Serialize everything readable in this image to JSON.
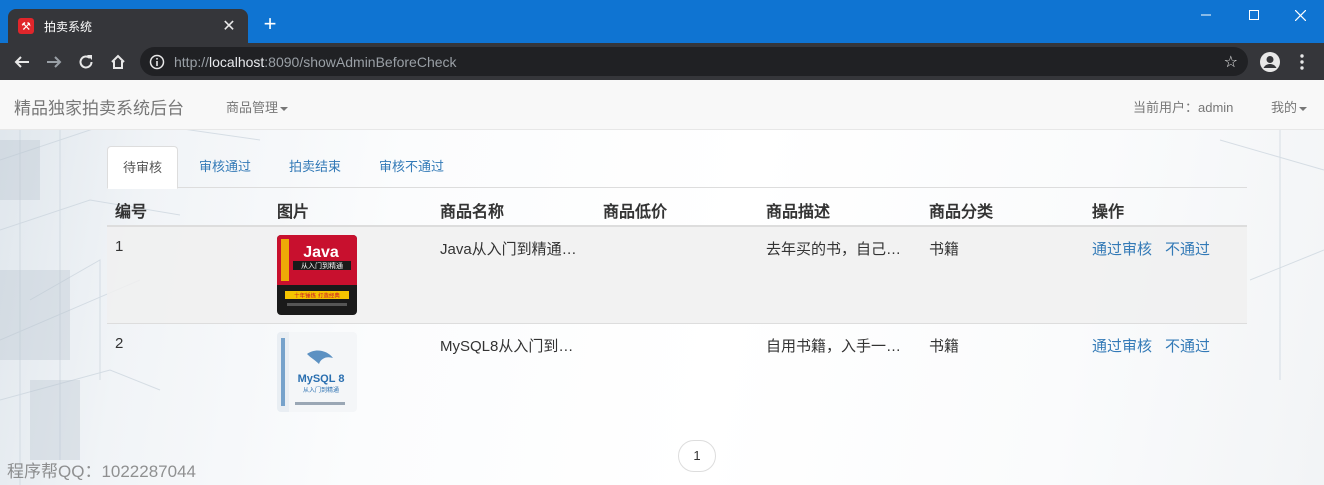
{
  "browser": {
    "tab_title": "拍卖系统",
    "tab_close": "✕",
    "new_tab": "+",
    "url_prefix": "http://",
    "url_host": "localhost",
    "url_rest": ":8090/showAdminBeforeCheck"
  },
  "navbar": {
    "brand": "精品独家拍卖系统后台",
    "menu_goods": "商品管理",
    "current_user": "当前用户：admin",
    "menu_mine": "我的"
  },
  "tabs": [
    "待审核",
    "审核通过",
    "拍卖结束",
    "审核不通过"
  ],
  "table": {
    "headers": [
      "编号",
      "图片",
      "商品名称",
      "商品低价",
      "商品描述",
      "商品分类",
      "操作"
    ],
    "rows": [
      {
        "id": "1",
        "name": "Java从入门到精通…",
        "price": "",
        "desc": "去年买的书，自己…",
        "category": "书籍",
        "approve": "通过审核",
        "reject": "不通过"
      },
      {
        "id": "2",
        "name": "MySQL8从入门到…",
        "price": "",
        "desc": "自用书籍，入手一…",
        "category": "书籍",
        "approve": "通过审核",
        "reject": "不通过"
      }
    ]
  },
  "book_covers": [
    {
      "title": "Java",
      "subtitle": "从入门到精通",
      "banner": "十年锤炼 打造经典",
      "colors": [
        "#c8102e",
        "#1a1a1a",
        "#f5c400"
      ]
    },
    {
      "title": "MySQL 8",
      "subtitle": "从入门到精通",
      "colors": [
        "#e9eef3",
        "#2a6fb0"
      ]
    }
  ],
  "pagination": {
    "current": "1"
  },
  "watermark": "程序帮QQ：1022287044"
}
